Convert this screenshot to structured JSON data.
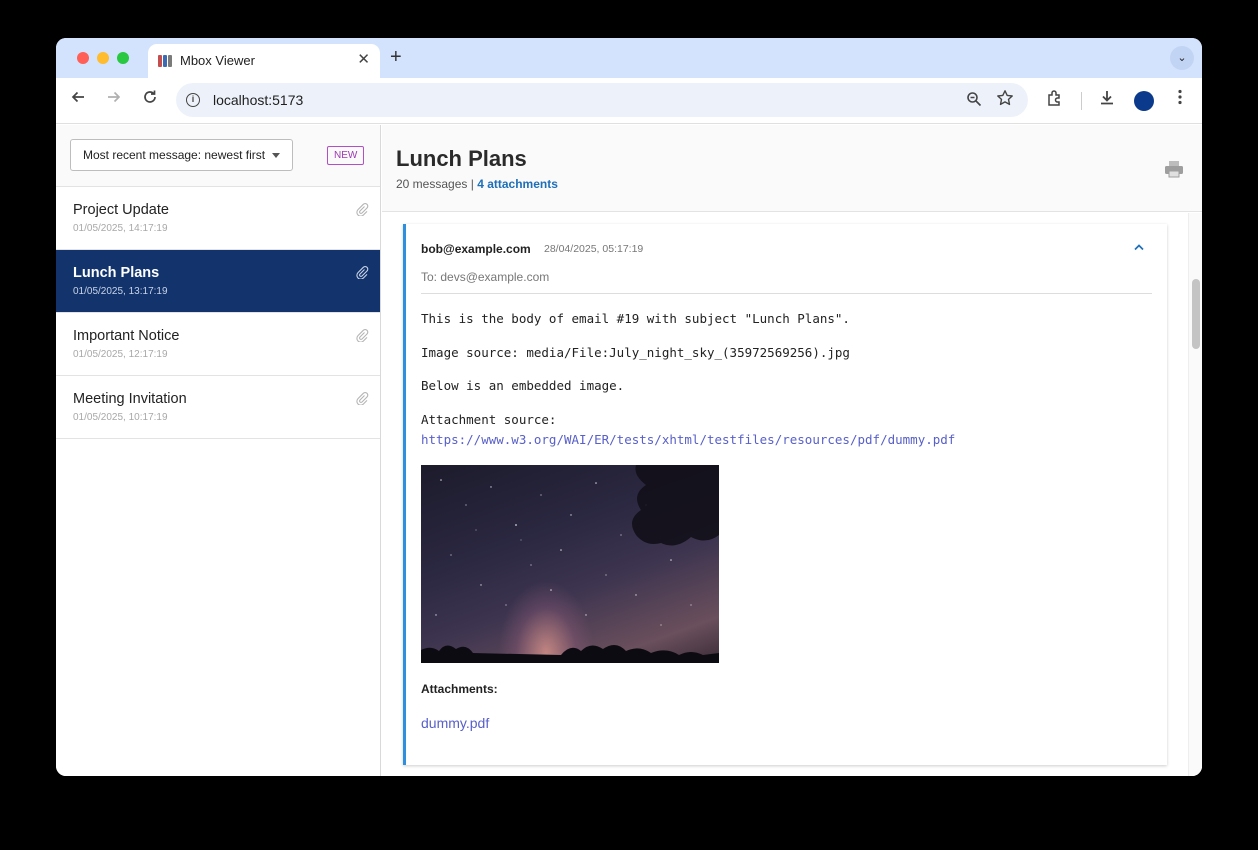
{
  "browser": {
    "tab_title": "Mbox Viewer",
    "tab_close": "✕",
    "new_tab": "+",
    "tab_menu": "⌄",
    "url": "localhost:5173",
    "info_glyph": "i"
  },
  "sidebar": {
    "sort_label": "Most recent message: newest first",
    "new_badge": "NEW",
    "threads": [
      {
        "subject": "Project Update",
        "date": "01/05/2025, 14:17:19",
        "active": false
      },
      {
        "subject": "Lunch Plans",
        "date": "01/05/2025, 13:17:19",
        "active": true
      },
      {
        "subject": "Important Notice",
        "date": "01/05/2025, 12:17:19",
        "active": false
      },
      {
        "subject": "Meeting Invitation",
        "date": "01/05/2025, 10:17:19",
        "active": false
      }
    ]
  },
  "thread_view": {
    "title": "Lunch Plans",
    "message_count": "20 messages",
    "separator": "|",
    "attachments_link": "4 attachments"
  },
  "message": {
    "from": "bob@example.com",
    "date": "28/04/2025, 05:17:19",
    "to": "To: devs@example.com",
    "body_lines": [
      "This is the body of email #19 with subject \"Lunch Plans\".",
      "Image source: media/File:July_night_sky_(35972569256).jpg",
      "Below is an embedded image.",
      "Attachment source:"
    ],
    "attachment_source_url": "https://www.w3.org/WAI/ER/tests/xhtml/testfiles/resources/pdf/dummy.pdf",
    "attachments_label": "Attachments:",
    "attachment_file": "dummy.pdf"
  },
  "colors": {
    "accent": "#2f8fdf",
    "selected_thread": "#12336c",
    "link": "#5860c9",
    "badge": "#9c3ab3"
  }
}
